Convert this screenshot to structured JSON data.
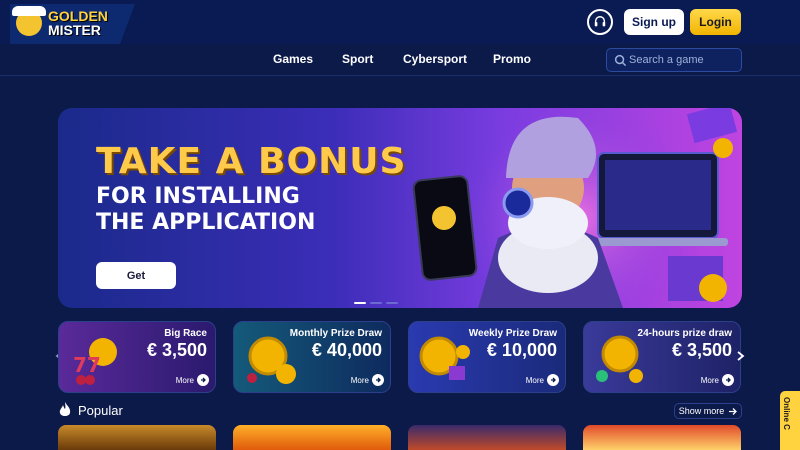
{
  "brand": {
    "line1": "GOLDEN",
    "line2": "MISTER"
  },
  "header": {
    "signup_label": "Sign up",
    "login_label": "Login"
  },
  "nav": {
    "items": [
      {
        "label": "Games"
      },
      {
        "label": "Sport"
      },
      {
        "label": "Cybersport"
      },
      {
        "label": "Promo"
      }
    ],
    "search_placeholder": "Search a game"
  },
  "banner": {
    "title": "TAKE A BONUS",
    "subtitle_line1": "FOR INSTALLING",
    "subtitle_line2": "THE APPLICATION",
    "cta_label": "Get",
    "slide_count": 3,
    "active_slide": 1
  },
  "promos": [
    {
      "title": "Big Race",
      "amount": "€ 3,500",
      "more": "More",
      "color": "#3a1a6e"
    },
    {
      "title": "Monthly Prize Draw",
      "amount": "€ 40,000",
      "more": "More",
      "color": "#0e3a5e"
    },
    {
      "title": "Weekly Prize Draw",
      "amount": "€ 10,000",
      "more": "More",
      "color": "#1a2a7a"
    },
    {
      "title": "24-hours prize draw",
      "amount": "€ 3,500",
      "more": "More",
      "color": "#2a2a6e"
    }
  ],
  "popular": {
    "title": "Popular",
    "show_more": "Show more"
  },
  "chat_tab": {
    "label": "Online C"
  },
  "colors": {
    "accent": "#ffd23f",
    "header_bg": "#0a1a52",
    "page_bg": "#0c1a4a"
  }
}
